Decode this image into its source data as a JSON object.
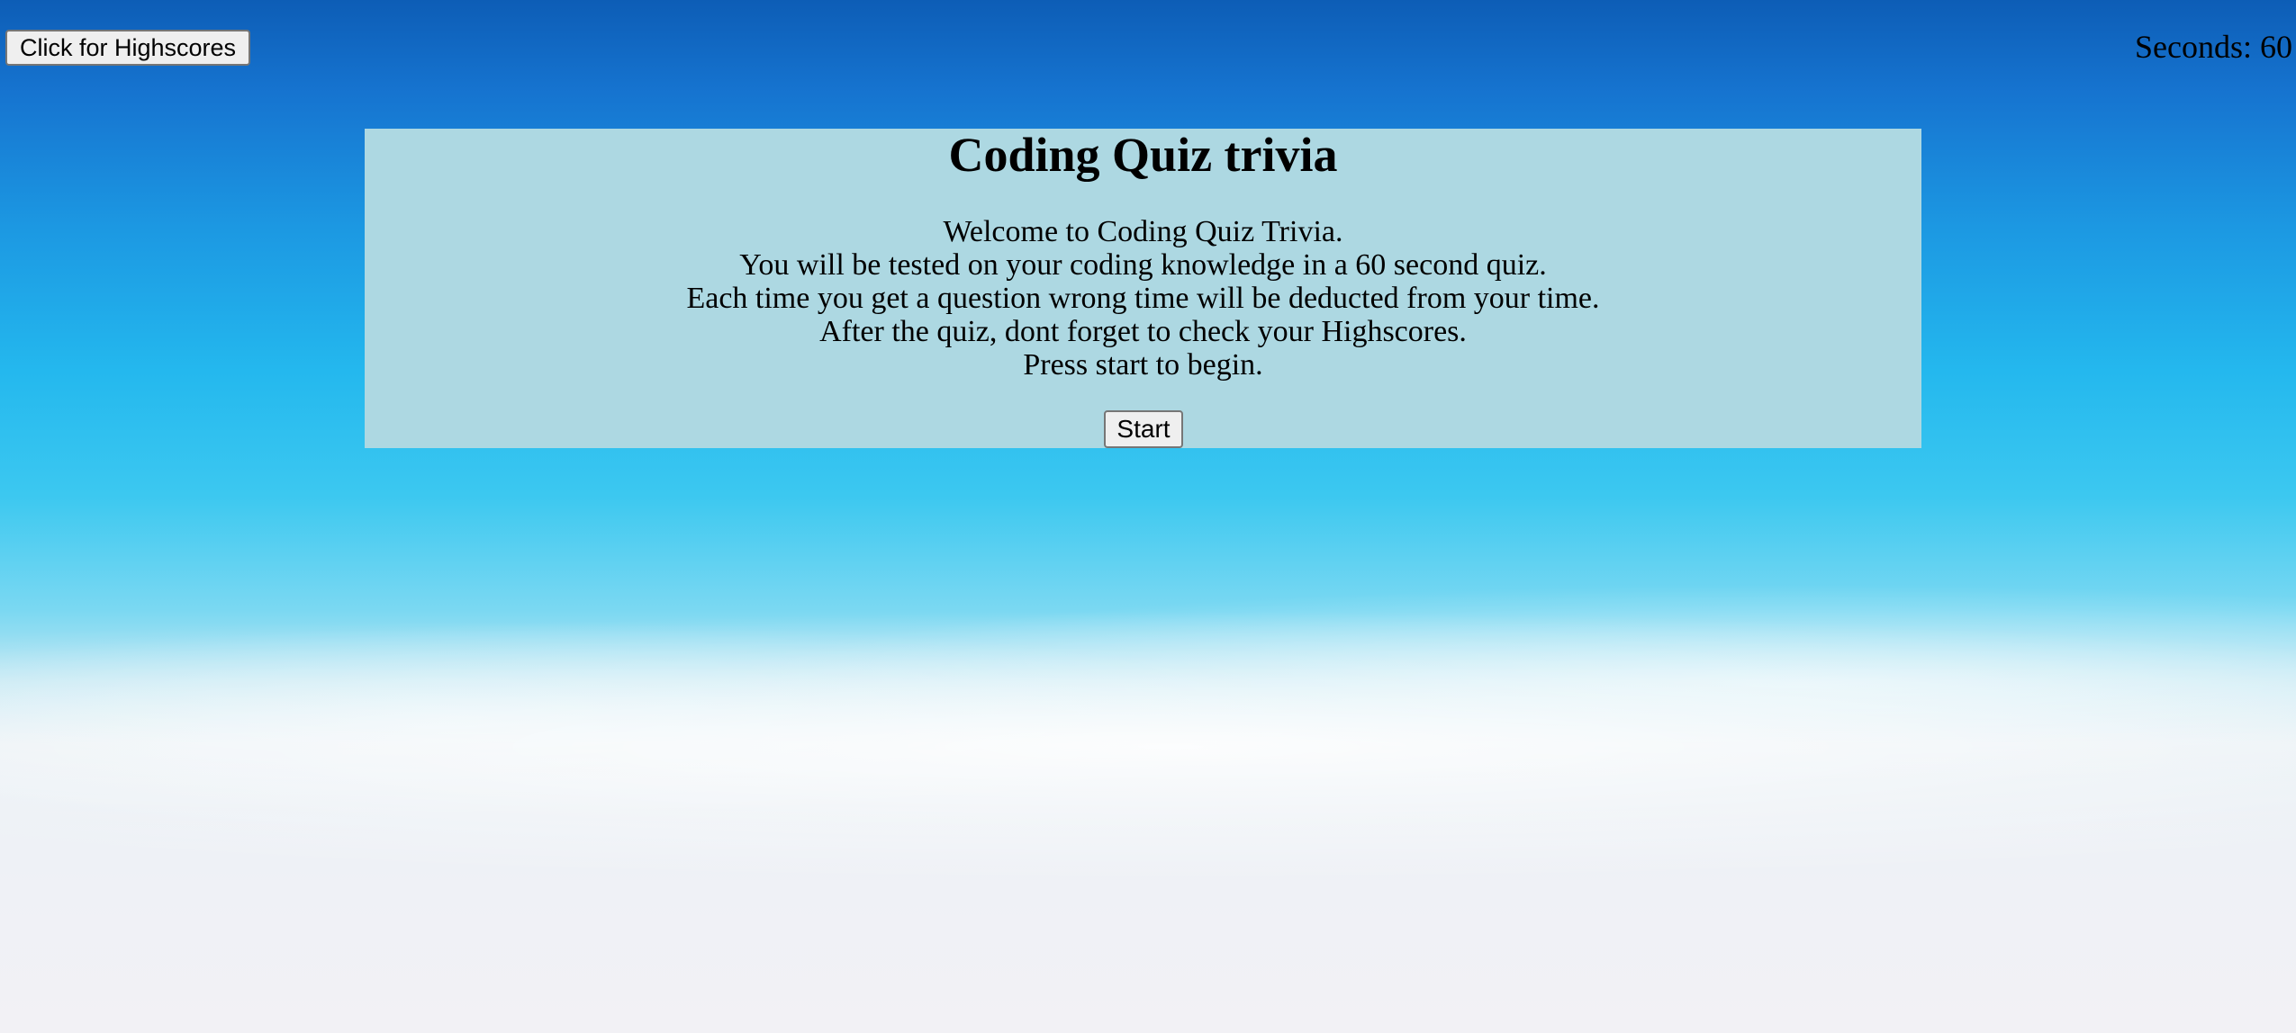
{
  "header": {
    "highscores_button_label": "Click for Highscores",
    "timer_text": "Seconds: 60"
  },
  "quiz": {
    "title": "Coding Quiz trivia",
    "intro_lines": [
      "Welcome to Coding Quiz Trivia.",
      "You will be tested on your coding knowledge in a 60 second quiz.",
      "Each time you get a question wrong time will be deducted from your time.",
      "After the quiz, dont forget to check your Highscores.",
      "Press start to begin."
    ],
    "start_button_label": "Start"
  },
  "colors": {
    "panel_background": "#add8e2",
    "sky_top": "#0d5db6",
    "sky_bottom": "#f2f1f5"
  }
}
